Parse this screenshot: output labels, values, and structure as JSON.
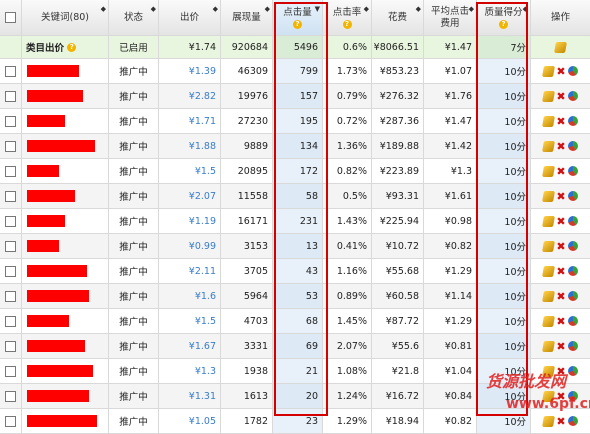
{
  "headers": {
    "keyword": "关键词(80)",
    "status": "状态",
    "bid": "出价",
    "impressions": "展现量",
    "clicks": "点击量",
    "ctr": "点击率",
    "cost": "花费",
    "avg_cpc_line1": "平均点击",
    "avg_cpc_line2": "费用",
    "quality": "质量得分",
    "actions": "操作"
  },
  "summary": {
    "label": "类目出价",
    "status": "已启用",
    "bid": "¥1.74",
    "impressions": "920684",
    "clicks": "5496",
    "ctr": "0.6%",
    "cost": "¥8066.51",
    "cpc": "¥1.47",
    "quality": "7分"
  },
  "rows": [
    {
      "status": "推广中",
      "bid": "¥1.39",
      "impressions": "46309",
      "clicks": "799",
      "ctr": "1.73%",
      "cost": "¥853.23",
      "cpc": "¥1.07",
      "quality": "10分"
    },
    {
      "status": "推广中",
      "bid": "¥2.82",
      "impressions": "19976",
      "clicks": "157",
      "ctr": "0.79%",
      "cost": "¥276.32",
      "cpc": "¥1.76",
      "quality": "10分"
    },
    {
      "status": "推广中",
      "bid": "¥1.71",
      "impressions": "27230",
      "clicks": "195",
      "ctr": "0.72%",
      "cost": "¥287.36",
      "cpc": "¥1.47",
      "quality": "10分"
    },
    {
      "status": "推广中",
      "bid": "¥1.88",
      "impressions": "9889",
      "clicks": "134",
      "ctr": "1.36%",
      "cost": "¥189.88",
      "cpc": "¥1.42",
      "quality": "10分"
    },
    {
      "status": "推广中",
      "bid": "¥1.5",
      "impressions": "20895",
      "clicks": "172",
      "ctr": "0.82%",
      "cost": "¥223.89",
      "cpc": "¥1.3",
      "quality": "10分"
    },
    {
      "status": "推广中",
      "bid": "¥2.07",
      "impressions": "11558",
      "clicks": "58",
      "ctr": "0.5%",
      "cost": "¥93.31",
      "cpc": "¥1.61",
      "quality": "10分"
    },
    {
      "status": "推广中",
      "bid": "¥1.19",
      "impressions": "16171",
      "clicks": "231",
      "ctr": "1.43%",
      "cost": "¥225.94",
      "cpc": "¥0.98",
      "quality": "10分"
    },
    {
      "status": "推广中",
      "bid": "¥0.99",
      "impressions": "3153",
      "clicks": "13",
      "ctr": "0.41%",
      "cost": "¥10.72",
      "cpc": "¥0.82",
      "quality": "10分"
    },
    {
      "status": "推广中",
      "bid": "¥2.11",
      "impressions": "3705",
      "clicks": "43",
      "ctr": "1.16%",
      "cost": "¥55.68",
      "cpc": "¥1.29",
      "quality": "10分"
    },
    {
      "status": "推广中",
      "bid": "¥1.6",
      "impressions": "5964",
      "clicks": "53",
      "ctr": "0.89%",
      "cost": "¥60.58",
      "cpc": "¥1.14",
      "quality": "10分"
    },
    {
      "status": "推广中",
      "bid": "¥1.5",
      "impressions": "4703",
      "clicks": "68",
      "ctr": "1.45%",
      "cost": "¥87.72",
      "cpc": "¥1.29",
      "quality": "10分"
    },
    {
      "status": "推广中",
      "bid": "¥1.67",
      "impressions": "3331",
      "clicks": "69",
      "ctr": "2.07%",
      "cost": "¥55.6",
      "cpc": "¥0.81",
      "quality": "10分"
    },
    {
      "status": "推广中",
      "bid": "¥1.3",
      "impressions": "1938",
      "clicks": "21",
      "ctr": "1.08%",
      "cost": "¥21.8",
      "cpc": "¥1.04",
      "quality": "10分"
    },
    {
      "status": "推广中",
      "bid": "¥1.31",
      "impressions": "1613",
      "clicks": "20",
      "ctr": "1.24%",
      "cost": "¥16.72",
      "cpc": "¥0.84",
      "quality": "10分"
    },
    {
      "status": "推广中",
      "bid": "¥1.05",
      "impressions": "1782",
      "clicks": "23",
      "ctr": "1.29%",
      "cost": "¥18.94",
      "cpc": "¥0.82",
      "quality": "10分"
    }
  ],
  "redact_widths": [
    52,
    56,
    38,
    68,
    32,
    48,
    38,
    32,
    60,
    62,
    42,
    58,
    66,
    62,
    70
  ],
  "watermark": {
    "line1": "货源批发网",
    "line2": "www.6pf.cn"
  },
  "colors": {
    "accent_box": "#d40000",
    "redaction": "#ff0000",
    "bid_link": "#3a7dc9",
    "summary_bg": "#e9f6df"
  }
}
